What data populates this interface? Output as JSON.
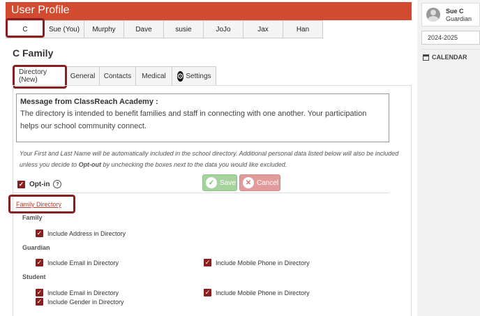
{
  "header": {
    "title": "User Profile"
  },
  "member_tabs": [
    "C",
    "Sue (You)",
    "Murphy",
    "Dave",
    "susie",
    "JoJo",
    "Jax",
    "Han"
  ],
  "family_name": "C Family",
  "subtabs": [
    "Directory (New)",
    "General",
    "Contacts",
    "Medical",
    "Settings"
  ],
  "message": {
    "title": "Message from ClassReach Academy :",
    "body": "The directory is intended to benefit families and staff in connecting with one another. Your participation helps our school community connect."
  },
  "note": {
    "part1": "Your First and Last Name will be automatically included in the school directory. Additional personal data listed below will also be included unless you decide to ",
    "opt_out": "Opt-out",
    "part2": " by unchecking the boxes next to the data you would like excluded."
  },
  "optin": {
    "label": "Opt-in",
    "checked": true
  },
  "buttons": {
    "save": "Save",
    "cancel": "Cancel"
  },
  "family_directory_link": "Family Directory",
  "sections": {
    "family": {
      "title": "Family",
      "items": [
        "Include Address in Directory"
      ]
    },
    "guardian": {
      "title": "Guardian",
      "items": [
        "Include Email in Directory",
        "Include Mobile Phone in Directory"
      ]
    },
    "student": {
      "title": "Student",
      "items": [
        "Include Email in Directory",
        "Include Mobile Phone in Directory",
        "Include Gender in Directory"
      ]
    }
  },
  "sidebar": {
    "user_name": "Sue C",
    "user_role": "Guardian",
    "school_year": "2024-2025",
    "calendar_label": "CALENDAR"
  },
  "colors": {
    "header": "#d24a30",
    "checkbox": "#8b1f1f",
    "save": "#a6d39d",
    "cancel": "#e29b9b",
    "highlight": "#8b1f1f"
  },
  "icons": [
    "settings-gear-icon",
    "help-icon",
    "check-icon",
    "close-icon",
    "calendar-icon",
    "avatar-icon"
  ]
}
